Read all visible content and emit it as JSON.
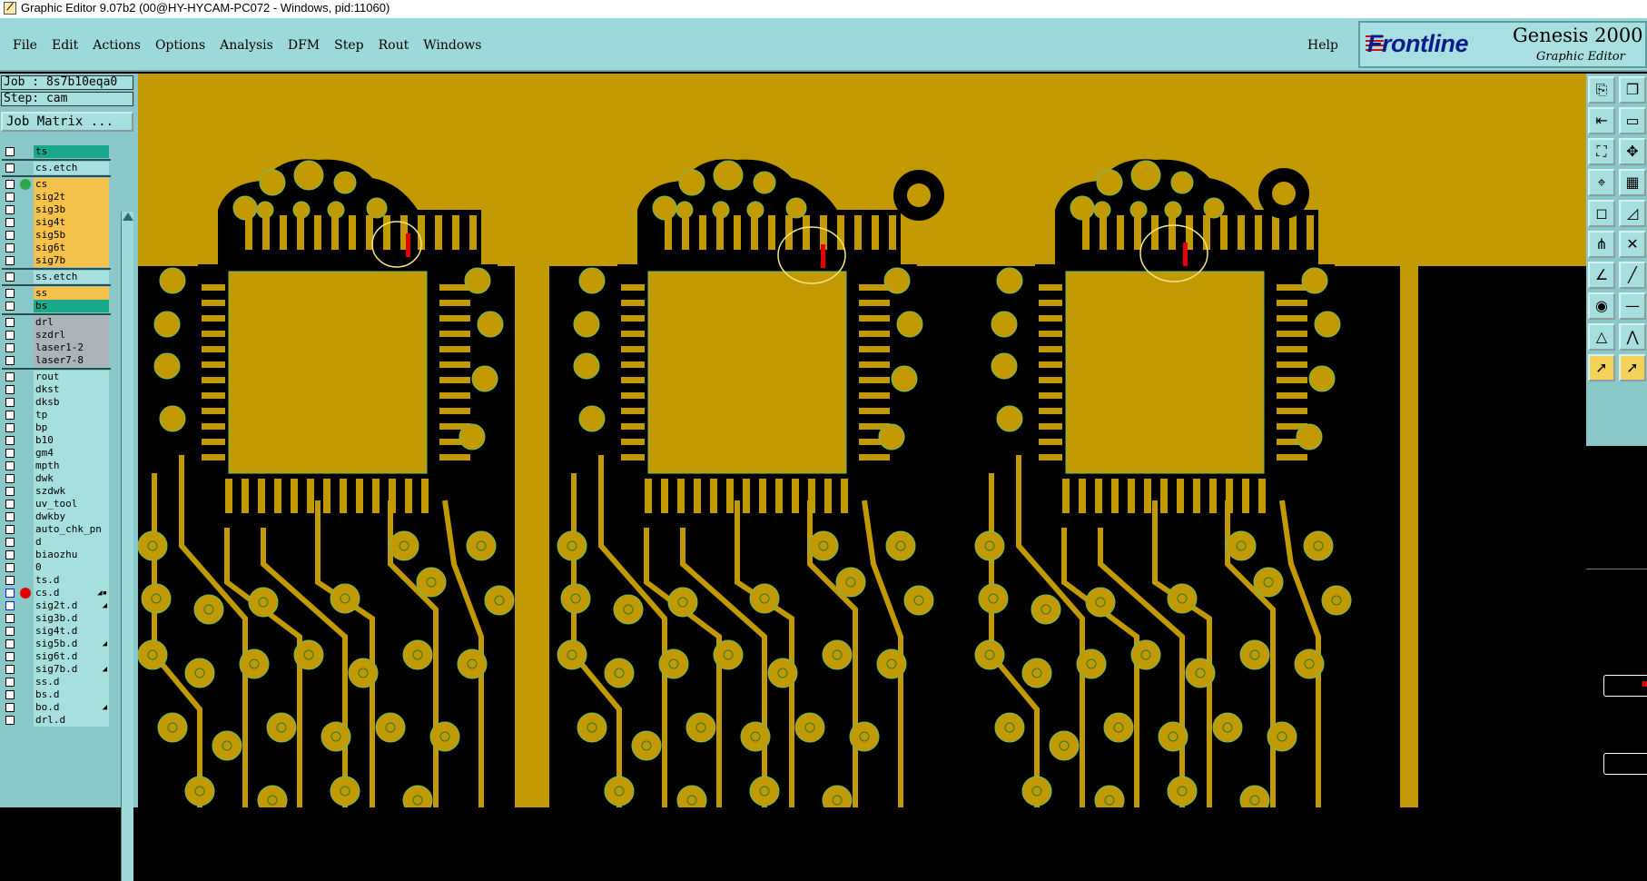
{
  "window": {
    "title": "Graphic Editor 9.07b2 (00@HY-HYCAM-PC072 - Windows, pid:11060)"
  },
  "menu": {
    "items": [
      "File",
      "Edit",
      "Actions",
      "Options",
      "Analysis",
      "DFM",
      "Step",
      "Rout",
      "Windows"
    ],
    "help": "Help"
  },
  "branding": {
    "logo": "Frontline",
    "product": "Genesis 2000",
    "subtitle": "Graphic Editor"
  },
  "job": {
    "job_label": "Job : 8s7b10eqa0",
    "step_label": "Step: cam",
    "matrix_button": "Job Matrix ..."
  },
  "colors": {
    "copper": "#c29a00",
    "board_black": "#000000",
    "highlight_red": "#e60000",
    "highlight_circle": "#f2e88a",
    "panel_cyan": "#9ed9da",
    "layer_teal": "#1aa88a",
    "layer_orange": "#f4c24a",
    "layer_gray": "#a9b3b8",
    "layer_cyan": "#a7dede"
  },
  "layers": [
    {
      "name": "ts",
      "color": "teal"
    },
    {
      "name": "cs.etch",
      "color": "cyan"
    },
    {
      "name": "cs",
      "color": "orange",
      "dot": "green"
    },
    {
      "name": "sig2t",
      "color": "orange"
    },
    {
      "name": "sig3b",
      "color": "orange"
    },
    {
      "name": "sig4t",
      "color": "orange"
    },
    {
      "name": "sig5b",
      "color": "orange"
    },
    {
      "name": "sig6t",
      "color": "orange"
    },
    {
      "name": "sig7b",
      "color": "orange"
    },
    {
      "name": "ss.etch",
      "color": "cyan"
    },
    {
      "name": "ss",
      "color": "orange"
    },
    {
      "name": "bs",
      "color": "teal"
    },
    {
      "name": "drl",
      "color": "gray"
    },
    {
      "name": "szdrl",
      "color": "gray"
    },
    {
      "name": "laser1-2",
      "color": "gray"
    },
    {
      "name": "laser7-8",
      "color": "gray"
    },
    {
      "name": "rout",
      "color": "cyan"
    },
    {
      "name": "dkst",
      "color": "cyan"
    },
    {
      "name": "dksb",
      "color": "cyan"
    },
    {
      "name": "tp",
      "color": "cyan"
    },
    {
      "name": "bp",
      "color": "cyan"
    },
    {
      "name": "b10",
      "color": "cyan"
    },
    {
      "name": "gm4",
      "color": "cyan"
    },
    {
      "name": "mpth",
      "color": "cyan"
    },
    {
      "name": "dwk",
      "color": "cyan"
    },
    {
      "name": "szdwk",
      "color": "cyan"
    },
    {
      "name": "uv_tool",
      "color": "cyan"
    },
    {
      "name": "dwkby",
      "color": "cyan"
    },
    {
      "name": "auto_chk_pn",
      "color": "cyan"
    },
    {
      "name": "d",
      "color": "cyan"
    },
    {
      "name": "biaozhu",
      "color": "cyan"
    },
    {
      "name": "0",
      "color": "cyan"
    },
    {
      "name": "ts.d",
      "color": "cyan"
    },
    {
      "name": "cs.d",
      "color": "cyan",
      "dot": "red",
      "checkbox": "blue",
      "marker": "◢▪"
    },
    {
      "name": "sig2t.d",
      "color": "cyan",
      "checkbox": "blue",
      "marker": "◢"
    },
    {
      "name": "sig3b.d",
      "color": "cyan"
    },
    {
      "name": "sig4t.d",
      "color": "cyan"
    },
    {
      "name": "sig5b.d",
      "color": "cyan",
      "marker": "◢"
    },
    {
      "name": "sig6t.d",
      "color": "cyan"
    },
    {
      "name": "sig7b.d",
      "color": "cyan",
      "marker": "◢"
    },
    {
      "name": "ss.d",
      "color": "cyan"
    },
    {
      "name": "bs.d",
      "color": "cyan"
    },
    {
      "name": "bo.d",
      "color": "cyan",
      "marker": "◢"
    },
    {
      "name": "drl.d",
      "color": "cyan"
    }
  ],
  "toolbar": {
    "tools": [
      "paste-icon",
      "copy-window-icon",
      "move-left-icon",
      "window-icon",
      "fit-icon",
      "pan-icon",
      "measure-icon",
      "grid-icon",
      "select-box-icon",
      "edit-shape-icon",
      "network-icon",
      "cross-icon",
      "line-icon",
      "arc-icon",
      "pad-icon",
      "segment-icon",
      "triangle-icon",
      "polyline-icon",
      "pointer-icon",
      "pointer-alt-icon"
    ]
  }
}
